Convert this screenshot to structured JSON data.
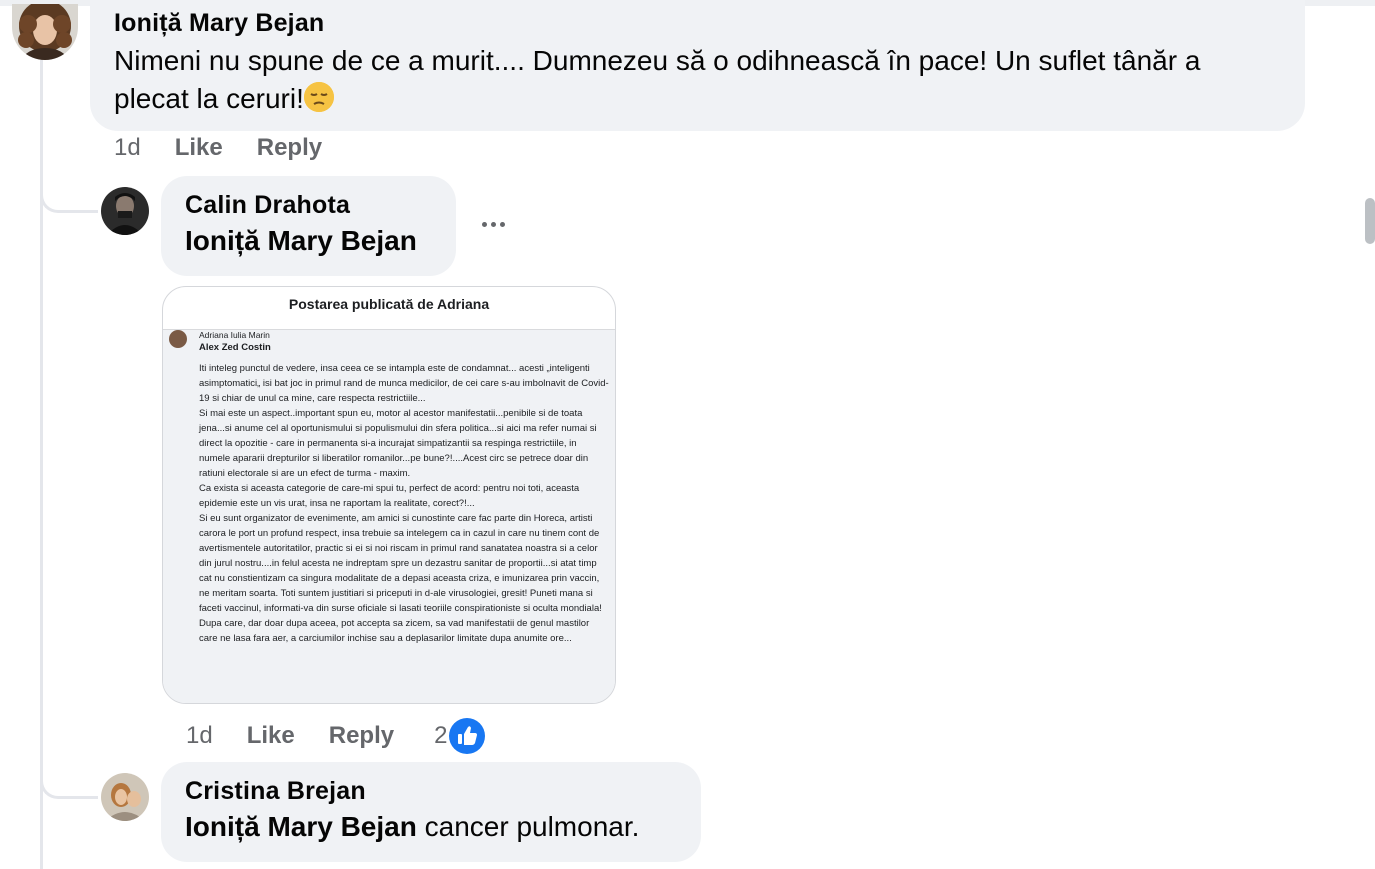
{
  "comment1": {
    "author": "Ioniță Mary Bejan",
    "text": "Nimeni nu spune de ce a murit.... Dumnezeu să o odihnească în pace! Un suflet tânăr a plecat la ceruri!",
    "emoji": "pensive-face",
    "time": "1d",
    "like_label": "Like",
    "reply_label": "Reply"
  },
  "reply1": {
    "author": "Calin Drahota",
    "mention": "Ioniță Mary Bejan",
    "time": "1d",
    "like_label": "Like",
    "reply_label": "Reply",
    "reaction_count": "2",
    "attachment": {
      "title": "Postarea publicată de Adriana",
      "post_author": "Adriana Iulia Marin",
      "post_mention": "Alex Zed Costin",
      "paragraphs": [
        "Iti inteleg punctul de vedere, insa ceea ce se intampla este de condamnat... acesti „inteligenti asimptomatici„ isi bat joc in primul rand de munca medicilor, de cei care s-au imbolnavit de Covid-19 si chiar de unul ca mine, care respecta restrictiile...",
        "Si mai este un aspect..important spun eu, motor al acestor manifestatii...penibile si de toata jena...si anume cel al oportunismului si populismului din sfera politica...si aici ma refer numai si direct la opozitie - care in permanenta si-a incurajat simpatizantii sa respinga restrictiile, in numele apararii drepturilor si liberatilor romanilor...pe bune?!....Acest circ se petrece doar din ratiuni electorale si are un efect de turma - maxim.",
        "Ca exista si aceasta categorie de care-mi spui tu, perfect de acord: pentru noi toti, aceasta epidemie este un vis urat, insa ne raportam la realitate, corect?!...",
        "Si eu sunt organizator de evenimente, am amici si cunostinte care fac parte din Horeca, artisti carora le port un profund respect, insa trebuie sa intelegem ca in cazul in care nu tinem cont de avertismentele autoritatilor, practic si ei si noi riscam in primul rand sanatatea noastra si a celor din jurul nostru....in felul acesta ne indreptam spre un dezastru sanitar de proportii...si atat timp cat nu constientizam ca singura modalitate de a depasi aceasta criza, e imunizarea prin vaccin, ne meritam soarta. Toti suntem justitiari si priceputi in d-ale virusologiei, gresit! Puneti mana si faceti vaccinul, informati-va din surse oficiale si lasati teoriile conspirationiste si oculta mondiala! Dupa care, dar doar dupa aceea, pot accepta sa zicem, sa vad manifestatii de genul mastilor care ne lasa fara aer, a carciumilor inchise sau a deplasarilor limitate dupa anumite ore..."
      ]
    }
  },
  "reply2": {
    "author": "Cristina Brejan",
    "mention": "Ioniță Mary Bejan",
    "text": " cancer pulmonar."
  },
  "colors": {
    "bubble": "#f0f2f5",
    "meta": "#65676b",
    "like_blue": "#1877f2",
    "thread_line": "#e4e6eb"
  }
}
